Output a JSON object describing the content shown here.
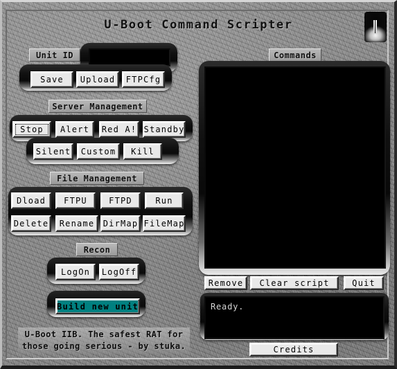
{
  "window": {
    "title": "U-Boot Command Scripter",
    "indicator_icon": "pause-indicator-icon"
  },
  "unit": {
    "label": "Unit ID",
    "input_value": "",
    "input_placeholder": "",
    "buttons": [
      {
        "label": "Save",
        "name": "save-button"
      },
      {
        "label": "Upload",
        "name": "upload-button"
      },
      {
        "label": "FTPCfg",
        "name": "ftpcfg-button"
      }
    ]
  },
  "server_management": {
    "label": "Server Management",
    "row1": [
      {
        "label": "Stop",
        "name": "stop-button",
        "focused": true
      },
      {
        "label": "Alert",
        "name": "alert-button",
        "focused": false
      },
      {
        "label": "Red A!",
        "name": "red-alert-button",
        "focused": false
      },
      {
        "label": "Standby",
        "name": "standby-button",
        "focused": false
      }
    ],
    "row2": [
      {
        "label": "Silent",
        "name": "silent-button"
      },
      {
        "label": "Custom",
        "name": "custom-button"
      },
      {
        "label": "Kill",
        "name": "kill-button"
      }
    ]
  },
  "file_management": {
    "label": "File Management",
    "row1": [
      {
        "label": "Dload",
        "name": "dload-button"
      },
      {
        "label": "FTPU",
        "name": "ftpu-button"
      },
      {
        "label": "FTPD",
        "name": "ftpd-button"
      },
      {
        "label": "Run",
        "name": "run-button"
      }
    ],
    "row2": [
      {
        "label": "Delete",
        "name": "delete-button"
      },
      {
        "label": "Rename",
        "name": "rename-button"
      },
      {
        "label": "DirMap",
        "name": "dirmap-button"
      },
      {
        "label": "FileMap",
        "name": "filemap-button"
      }
    ]
  },
  "recon": {
    "label": "Recon",
    "buttons": [
      {
        "label": "LogOn",
        "name": "logon-button"
      },
      {
        "label": "LogOff",
        "name": "logoff-button"
      }
    ],
    "build_button": {
      "label": "Build new unit",
      "name": "build-new-unit-button",
      "color": "#008080"
    }
  },
  "tagline": {
    "line1": "U-Boot IIB. The safest RAT for",
    "line2": "those going serious - by stuka."
  },
  "commands": {
    "label": "Commands",
    "script_content": "",
    "actions": [
      {
        "label": "Remove",
        "name": "remove-button"
      },
      {
        "label": "Clear script",
        "name": "clear-script-button"
      },
      {
        "label": "Quit",
        "name": "quit-button"
      }
    ]
  },
  "status": {
    "text": "Ready."
  },
  "credits": {
    "label": "Credits",
    "name": "credits-button"
  },
  "colors": {
    "accent_teal": "#008080",
    "panel_black": "#000000",
    "metal_gray": "#8a8a8a",
    "button_face": "#e9e9e9"
  }
}
